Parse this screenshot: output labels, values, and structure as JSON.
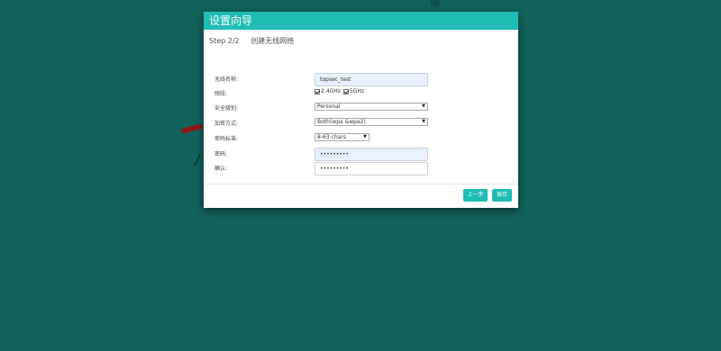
{
  "dialog": {
    "title": "设置向导",
    "step": "Step 2/2",
    "step_title": "创建无线网络"
  },
  "form": {
    "ssid": {
      "label": "无线名称:",
      "value": "topsec_test"
    },
    "band": {
      "label": "频段:",
      "options": [
        "2.4GHz",
        "5GHz"
      ],
      "checked": [
        true,
        true
      ]
    },
    "security_mode": {
      "label": "安全级别:",
      "selected": "Personal"
    },
    "encryption": {
      "label": "加密方式:",
      "selected": "Both(wpa &wpa2)"
    },
    "password_standard": {
      "label": "密码标准:",
      "selected": "8-63 chars"
    },
    "password": {
      "label": "密码:",
      "value": "•••••••••"
    },
    "confirm": {
      "label": "确认:",
      "value": "•••••••••"
    }
  },
  "buttons": {
    "prev": "上一步",
    "save": "保存"
  },
  "icons": {
    "select_arrow": "chevron-down-icon",
    "checkbox": "checkbox-checked-icon"
  },
  "colors": {
    "background": "#12635c",
    "accent": "#1fbcb4",
    "input_bg": "#e8f0fe"
  }
}
